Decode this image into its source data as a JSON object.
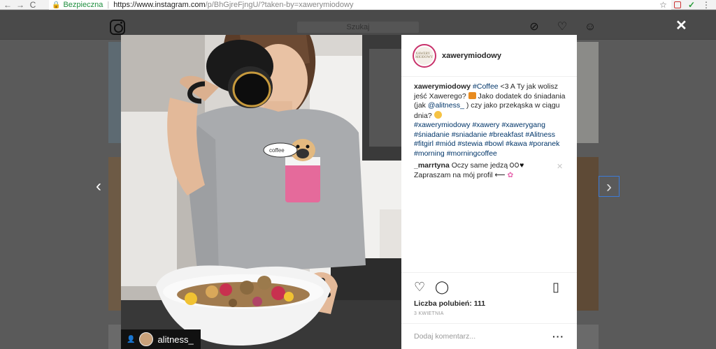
{
  "browser": {
    "secure_label": "Bezpieczna",
    "url_host": "https://www.instagram.com",
    "url_path": "/p/BhGjreFjngU/?taken-by=xawerymiodowy"
  },
  "header": {
    "search_placeholder": "Szukaj"
  },
  "post": {
    "username": "xawerymiodowy",
    "avatar_text": "XAWERY MIODOWY",
    "caption_user": "xawerymiodowy",
    "caption_tag1": "#Coffee",
    "caption_text1": " <3 A Ty jak wolisz jeść Xawerego? ",
    "caption_text2": " Jako dodatek do śniadania (jak ",
    "caption_mention": "@alitness_",
    "caption_text3": " ) czy jako przekąska w ciągu dnia? ",
    "hashtags": "#xawerymiodowy #xawery #xawerygang #śniadanie #sniadanie #breakfast #Alitness #fitgirl #miód #stewia #bowl #kawa #poranek #morning #morningcoffee",
    "comment_user": "_marrtyna",
    "comment_text1": " Oczy same jedzą ",
    "comment_text2": "Zapraszam na mój profil ",
    "likes_label": "Liczba polubień:",
    "likes_count": "111",
    "date": "3 KWIETNIA",
    "add_comment_placeholder": "Dodaj komentarz...",
    "tagged_user": "alitness_"
  },
  "colors": {
    "link": "#003569",
    "secure": "#1e8e3e",
    "avatar_ring": "#c8316a"
  }
}
